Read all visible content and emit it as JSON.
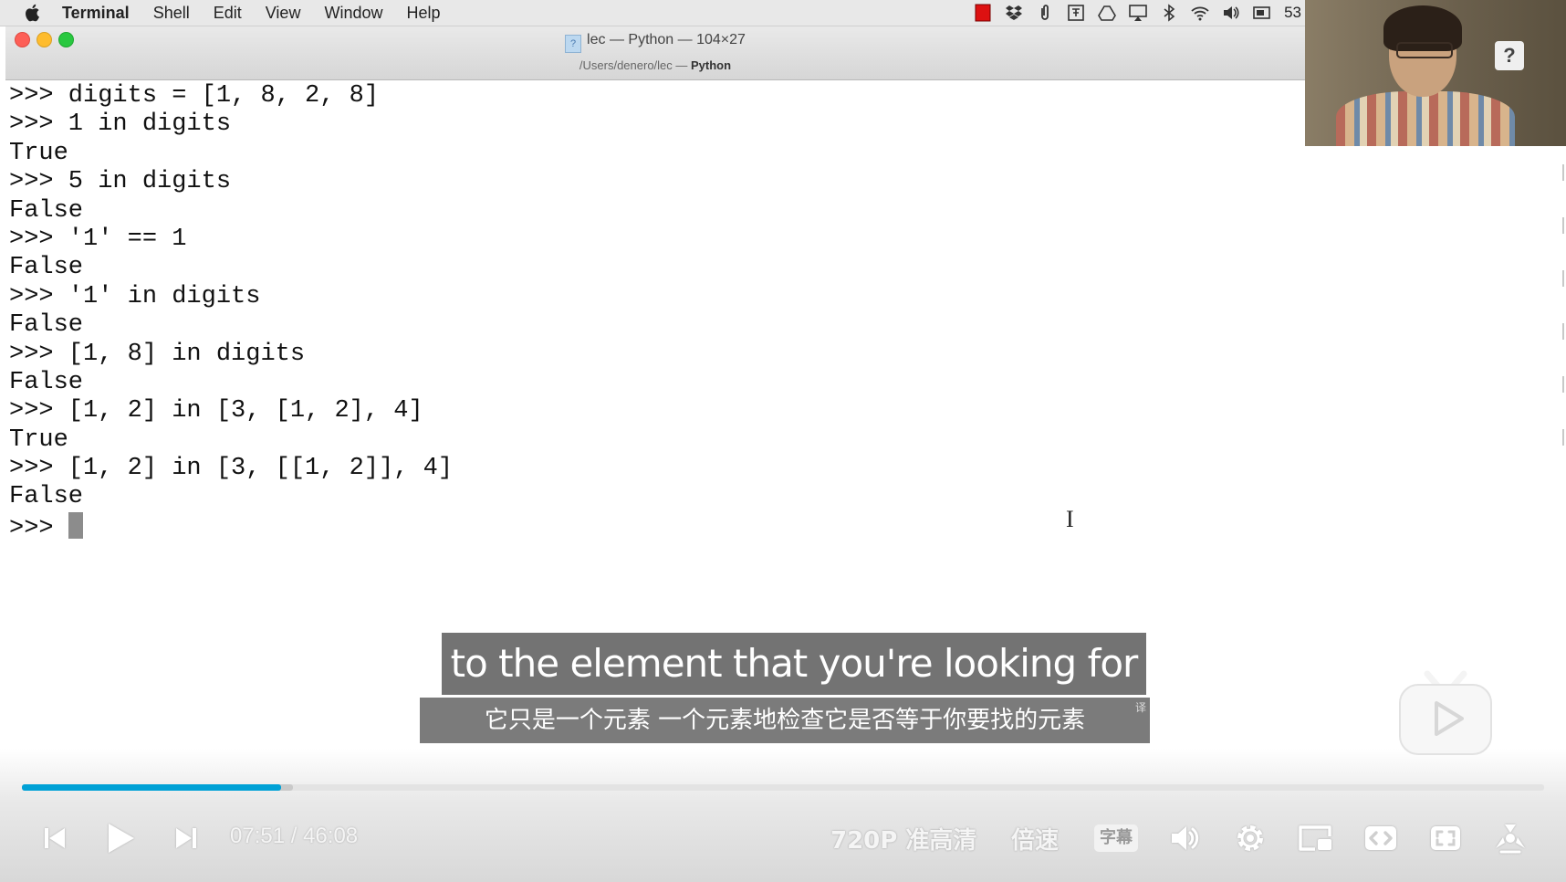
{
  "menubar": {
    "app_name": "Terminal",
    "items": [
      "Shell",
      "Edit",
      "View",
      "Window",
      "Help"
    ],
    "status_clip": "53"
  },
  "window": {
    "title": "lec — Python — 104×27",
    "subtitle_path": "/Users/denero/lec — ",
    "subtitle_app": "Python"
  },
  "terminal": {
    "lines": [
      ">>> digits = [1, 8, 2, 8]",
      ">>> 1 in digits",
      "True",
      ">>> 5 in digits",
      "False",
      ">>> '1' == 1",
      "False",
      ">>> '1' in digits",
      "False",
      ">>> [1, 8] in digits",
      "False",
      ">>> [1, 2] in [3, [1, 2], 4]",
      "True",
      ">>> [1, 2] in [3, [[1, 2]], 4]",
      "False"
    ],
    "prompt": ">>> "
  },
  "webcam": {
    "help_badge": "?"
  },
  "subtitles": {
    "english": "to the element that you're looking for",
    "chinese": "它只是一个元素 一个元素地检查它是否等于你要找的元素",
    "chinese_tag": "译"
  },
  "player": {
    "current_time": "07:51",
    "separator": " / ",
    "duration": "46:08",
    "progress_fraction": 0.1702,
    "buffered_fraction": 0.178,
    "quality_label": "720P 准高清",
    "speed_label": "倍速",
    "subtitle_label": "字幕",
    "accent_color": "#00a1d6"
  },
  "icons": [
    "apple-icon",
    "record-icon",
    "dropbox-icon",
    "paperclip-icon",
    "hindi-input-icon",
    "drive-icon",
    "airplay-icon",
    "bluetooth-icon",
    "wifi-icon",
    "volume-icon",
    "battery-icon",
    "prev-icon",
    "play-icon",
    "next-icon",
    "volume-icon",
    "settings-icon",
    "pip-icon",
    "widescreen-icon",
    "fullscreen-icon",
    "ufo-icon",
    "bilibili-tv-icon",
    "ibeam-cursor-icon"
  ]
}
